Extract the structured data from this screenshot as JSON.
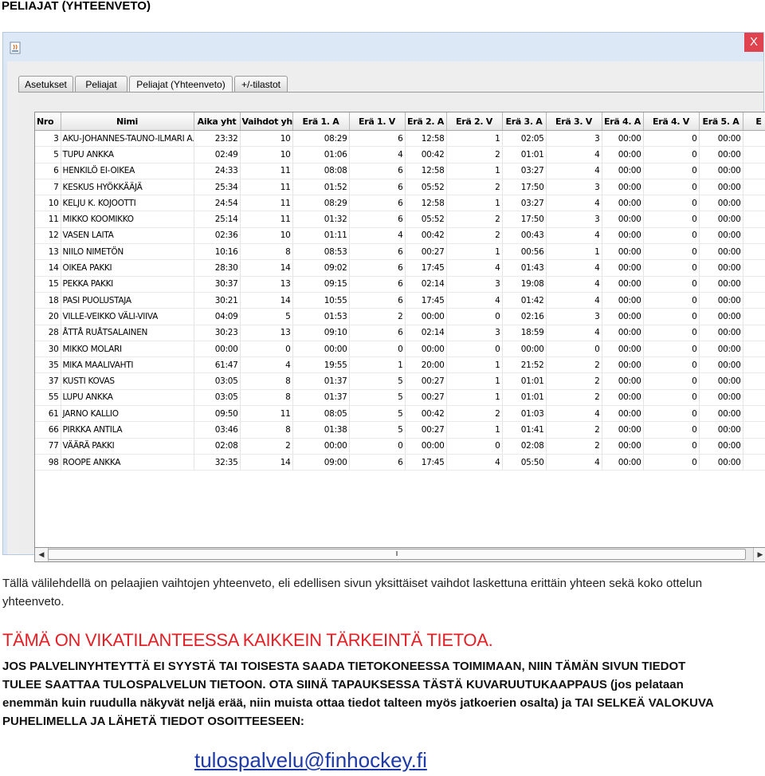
{
  "doc_heading": "PELIAJAT (YHTEENVETO)",
  "window": {
    "close_label": "X",
    "tabs": [
      "Asetukset",
      "Peliajat",
      "Peliajat (Yhteenveto)",
      "+/-tilastot"
    ],
    "active_tab_index": 2
  },
  "table": {
    "columns": [
      "Nro",
      "Nimi",
      "Aika yht",
      "Vaihdot yht",
      "Erä 1. A",
      "Erä 1. V",
      "Erä 2. A",
      "Erä 2. V",
      "Erä 3. A",
      "Erä 3. V",
      "Erä 4. A",
      "Erä 4. V",
      "Erä 5. A",
      "E"
    ],
    "rows": [
      [
        "3",
        "AKU-JOHANNES-TAUNO-ILMARI A...",
        "23:32",
        "10",
        "08:29",
        "6",
        "12:58",
        "1",
        "02:05",
        "3",
        "00:00",
        "0",
        "00:00",
        ""
      ],
      [
        "5",
        "TUPU ANKKA",
        "02:49",
        "10",
        "01:06",
        "4",
        "00:42",
        "2",
        "01:01",
        "4",
        "00:00",
        "0",
        "00:00",
        ""
      ],
      [
        "6",
        "HENKILÖ EI-OIKEA",
        "24:33",
        "11",
        "08:08",
        "6",
        "12:58",
        "1",
        "03:27",
        "4",
        "00:00",
        "0",
        "00:00",
        ""
      ],
      [
        "7",
        "KESKUS HYÖKKÄÄJÄ",
        "25:34",
        "11",
        "01:52",
        "6",
        "05:52",
        "2",
        "17:50",
        "3",
        "00:00",
        "0",
        "00:00",
        ""
      ],
      [
        "10",
        "KELJU K. KOJOOTTI",
        "24:54",
        "11",
        "08:29",
        "6",
        "12:58",
        "1",
        "03:27",
        "4",
        "00:00",
        "0",
        "00:00",
        ""
      ],
      [
        "11",
        "MIKKO KOOMIKKO",
        "25:14",
        "11",
        "01:32",
        "6",
        "05:52",
        "2",
        "17:50",
        "3",
        "00:00",
        "0",
        "00:00",
        ""
      ],
      [
        "12",
        "VASEN LAITA",
        "02:36",
        "10",
        "01:11",
        "4",
        "00:42",
        "2",
        "00:43",
        "4",
        "00:00",
        "0",
        "00:00",
        ""
      ],
      [
        "13",
        "NIILO NIMETÖN",
        "10:16",
        "8",
        "08:53",
        "6",
        "00:27",
        "1",
        "00:56",
        "1",
        "00:00",
        "0",
        "00:00",
        ""
      ],
      [
        "14",
        "OIKEA PAKKI",
        "28:30",
        "14",
        "09:02",
        "6",
        "17:45",
        "4",
        "01:43",
        "4",
        "00:00",
        "0",
        "00:00",
        ""
      ],
      [
        "15",
        "PEKKA PAKKI",
        "30:37",
        "13",
        "09:15",
        "6",
        "02:14",
        "3",
        "19:08",
        "4",
        "00:00",
        "0",
        "00:00",
        ""
      ],
      [
        "18",
        "PASI PUOLUSTAJA",
        "30:21",
        "14",
        "10:55",
        "6",
        "17:45",
        "4",
        "01:42",
        "4",
        "00:00",
        "0",
        "00:00",
        ""
      ],
      [
        "20",
        "VILLE-VEIKKO VÄLI-VIIVA",
        "04:09",
        "5",
        "01:53",
        "2",
        "00:00",
        "0",
        "02:16",
        "3",
        "00:00",
        "0",
        "00:00",
        ""
      ],
      [
        "28",
        "ÅTTÅ RUÅTSALAINEN",
        "30:23",
        "13",
        "09:10",
        "6",
        "02:14",
        "3",
        "18:59",
        "4",
        "00:00",
        "0",
        "00:00",
        ""
      ],
      [
        "30",
        "MIKKO MOLARI",
        "00:00",
        "0",
        "00:00",
        "0",
        "00:00",
        "0",
        "00:00",
        "0",
        "00:00",
        "0",
        "00:00",
        ""
      ],
      [
        "35",
        "MIKA MAALIVAHTI",
        "61:47",
        "4",
        "19:55",
        "1",
        "20:00",
        "1",
        "21:52",
        "2",
        "00:00",
        "0",
        "00:00",
        ""
      ],
      [
        "37",
        "KUSTI KOVAS",
        "03:05",
        "8",
        "01:37",
        "5",
        "00:27",
        "1",
        "01:01",
        "2",
        "00:00",
        "0",
        "00:00",
        ""
      ],
      [
        "55",
        "LUPU ANKKA",
        "03:05",
        "8",
        "01:37",
        "5",
        "00:27",
        "1",
        "01:01",
        "2",
        "00:00",
        "0",
        "00:00",
        ""
      ],
      [
        "61",
        "JARNO KALLIO",
        "09:50",
        "11",
        "08:05",
        "5",
        "00:42",
        "2",
        "01:03",
        "4",
        "00:00",
        "0",
        "00:00",
        ""
      ],
      [
        "66",
        "PIRKKA ANTILA",
        "03:46",
        "8",
        "01:38",
        "5",
        "00:27",
        "1",
        "01:41",
        "2",
        "00:00",
        "0",
        "00:00",
        ""
      ],
      [
        "77",
        "VÄÄRÄ PAKKI",
        "02:08",
        "2",
        "00:00",
        "0",
        "00:00",
        "0",
        "02:08",
        "2",
        "00:00",
        "0",
        "00:00",
        ""
      ],
      [
        "98",
        "ROOPE ANKKA",
        "32:35",
        "14",
        "09:00",
        "6",
        "17:45",
        "4",
        "05:50",
        "4",
        "00:00",
        "0",
        "00:00",
        ""
      ]
    ]
  },
  "description": "Tällä välilehdellä on pelaajien vaihtojen yhteenveto, eli edellisen sivun yksittäiset vaihdot laskettuna erittäin yhteen sekä koko ottelun yhteenveto.",
  "warning": "TÄMÄ ON VIKATILANTEESSA KAIKKEIN TÄRKEINTÄ TIETOA.",
  "instructions": "JOS PALVELINYHTEYTTÄ EI SYYSTÄ TAI TOISESTA SAADA TIETOKONEESSA TOIMIMAAN, NIIN TÄMÄN SIVUN TIEDOT TULEE SAATTAA TULOSPALVELUN TIETOON. OTA SIINÄ TAPAUKSESSA TÄSTÄ KUVARUUTUKAAPPAUS (jos pelataan enemmän kuin ruudulla näkyvät neljä erää, niin muista ottaa tiedot talteen myös jatkoerien osalta) ja TAI SELKEÄ VALOKUVA PUHELIMELLA JA LÄHETÄ TIEDOT OSOITTEESEEN:",
  "email": "tulospalvelu@finhockey.fi",
  "colors": {
    "warning": "#e31f26",
    "link": "#1d3aa8",
    "close": "#e0434d"
  },
  "icons": {
    "app": "java-app-icon",
    "close": "close-icon",
    "scroll_left": "arrow-left-icon",
    "scroll_right": "arrow-right-icon"
  }
}
